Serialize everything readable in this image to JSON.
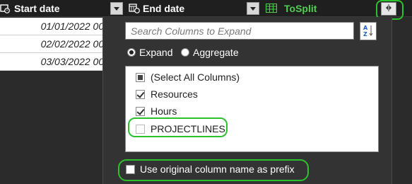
{
  "columns": [
    {
      "label": "Start date",
      "icon": "calendar-clock-icon"
    },
    {
      "label": "End date",
      "icon": "calendar-clock-icon"
    },
    {
      "label": "ToSplit",
      "icon": "table-icon"
    }
  ],
  "rows": [
    "01/01/2022 00:",
    "02/02/2022 00:",
    "03/03/2022 00:"
  ],
  "expand_button_icon": "expand-columns-icon",
  "panel": {
    "search_placeholder": "Search Columns to Expand",
    "sort_icon": "sort-az-icon",
    "radio_expand": "Expand",
    "radio_aggregate": "Aggregate",
    "selected_mode": "Expand",
    "items": [
      {
        "label": "(Select All Columns)",
        "state": "partial"
      },
      {
        "label": "Resources",
        "state": "checked"
      },
      {
        "label": "Hours",
        "state": "checked"
      },
      {
        "label": "PROJECTLINES",
        "state": "unchecked"
      }
    ],
    "prefix_label": "Use original column name as prefix",
    "prefix_checked": false
  },
  "colors": {
    "highlight": "#2ec12e",
    "column_green": "#4fd04f"
  }
}
